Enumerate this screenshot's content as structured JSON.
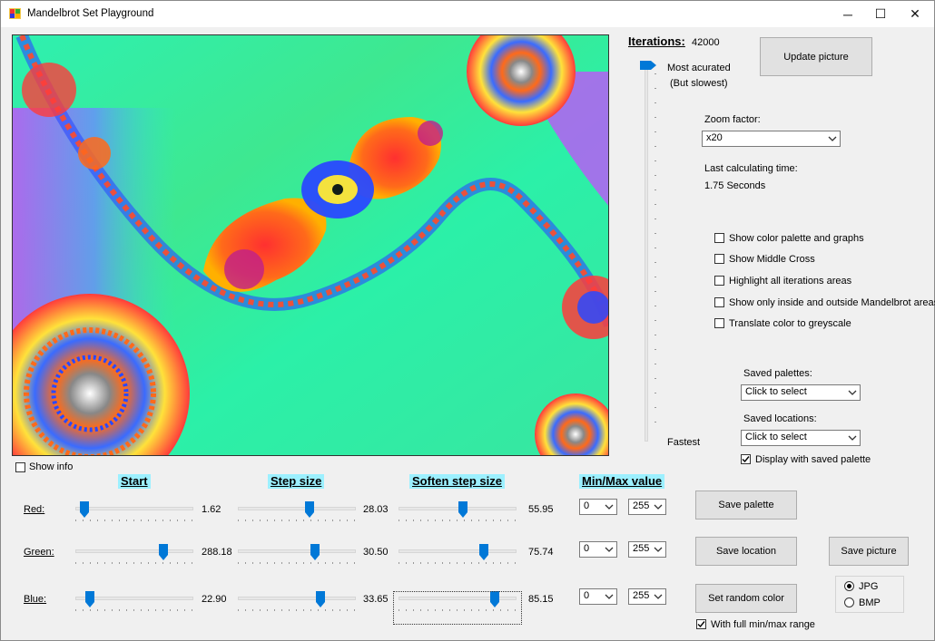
{
  "window": {
    "title": "Mandelbrot Set Playground",
    "minimize_glyph": "─",
    "maximize_glyph": "☐",
    "close_glyph": "✕"
  },
  "iterations": {
    "label": "Iterations:",
    "value": "42000",
    "most_accurate_label": "Most acurated",
    "most_accurate_sub": "(But slowest)",
    "fastest_label": "Fastest"
  },
  "update_button": "Update picture",
  "zoom": {
    "label": "Zoom factor:",
    "value": "x20"
  },
  "calc_time": {
    "label": "Last calculating time:",
    "value": "1.75 Seconds"
  },
  "options": [
    {
      "label": "Show color palette and graphs",
      "checked": false
    },
    {
      "label": "Show Middle Cross",
      "checked": false
    },
    {
      "label": "Highlight all iterations areas",
      "checked": false
    },
    {
      "label": "Show only inside and outside Mandelbrot areas",
      "checked": false
    },
    {
      "label": "Translate color to greyscale",
      "checked": false
    }
  ],
  "saved_palettes": {
    "label": "Saved palettes:",
    "value": "Click to select"
  },
  "saved_locations": {
    "label": "Saved locations:",
    "value": "Click to select"
  },
  "display_saved_palette": {
    "label": "Display with saved palette",
    "checked": true
  },
  "show_info": {
    "label": "Show info",
    "checked": false
  },
  "columns": {
    "start": "Start",
    "step": "Step size",
    "soften": "Soften step size",
    "minmax": "Min/Max value"
  },
  "rows": [
    {
      "label": "Red:",
      "start": "1.62",
      "step": "28.03",
      "soften": "55.95",
      "min": "0",
      "max": "255"
    },
    {
      "label": "Green:",
      "start": "288.18",
      "step": "30.50",
      "soften": "75.74",
      "min": "0",
      "max": "255"
    },
    {
      "label": "Blue:",
      "start": "22.90",
      "step": "33.65",
      "soften": "85.15",
      "min": "0",
      "max": "255"
    }
  ],
  "buttons": {
    "save_palette": "Save  palette",
    "save_location": "Save location",
    "save_picture": "Save picture",
    "random_color": "Set random color"
  },
  "full_range": {
    "label": "With full min/max range",
    "checked": true
  },
  "format": {
    "options": [
      "JPG",
      "BMP"
    ],
    "selected": "JPG"
  },
  "colors": {
    "accent": "#0078d7",
    "header_bg": "#9cf0ff",
    "window_bg": "#f0f0f0"
  }
}
